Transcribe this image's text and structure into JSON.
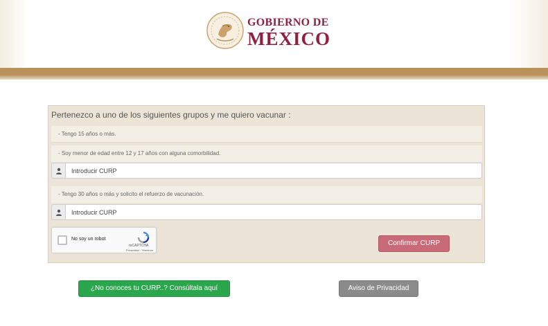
{
  "header": {
    "logo_line1": "GOBIERNO DE",
    "logo_line2": "MÉXICO"
  },
  "form": {
    "title": "Pertenezco a uno de los siguientes grupos y me quiero vacunar :",
    "notes": [
      "- Tengo 15 años o más.",
      "- Soy menor de edad entre 12 y 17 años con alguna comorbilidad.",
      "- Tengo 30 años o más y solicito el refuerzo de vacunación."
    ],
    "curp_inputs": [
      {
        "placeholder": "Introducir CURP",
        "value": ""
      },
      {
        "placeholder": "Introducir CURP",
        "value": ""
      }
    ],
    "user_icon": "user-icon",
    "recaptcha": {
      "label": "No soy un robot",
      "brand": "reCAPTCHA",
      "links": "Privacidad - Términos"
    },
    "confirm_label": "Confirmar CURP"
  },
  "footer": {
    "lookup_label": "¿No conoces tu CURP..? Consúltala aquí",
    "privacy_label": "Aviso de Privacidad"
  },
  "colors": {
    "brand": "#8f2041",
    "gold": "#b8925a",
    "panel_bg": "#ece5d7",
    "confirm": "#c86a78",
    "green": "#2aa64d",
    "gray": "#8b8b8b"
  }
}
